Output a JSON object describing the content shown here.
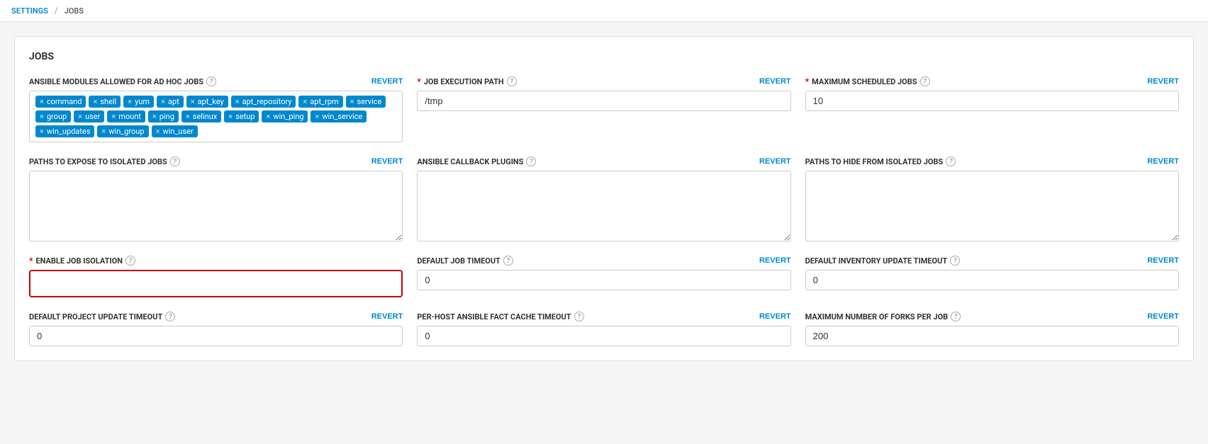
{
  "breadcrumb": {
    "settings": "SETTINGS",
    "separator": "/",
    "current": "JOBS"
  },
  "card": {
    "title": "JOBS"
  },
  "fields": {
    "ansible_modules": {
      "label": "ANSIBLE MODULES ALLOWED FOR AD HOC JOBS",
      "required": false,
      "help": "?",
      "revert": "REVERT",
      "tags": [
        "command",
        "shell",
        "yum",
        "apt",
        "apt_key",
        "apt_repository",
        "apt_rpm",
        "service",
        "group",
        "user",
        "mount",
        "ping",
        "selinux",
        "setup",
        "win_ping",
        "win_service",
        "win_updates",
        "win_group",
        "win_user"
      ]
    },
    "job_execution_path": {
      "label": "JOB EXECUTION PATH",
      "required": true,
      "help": "?",
      "revert": "REVERT",
      "value": "/tmp"
    },
    "max_scheduled_jobs": {
      "label": "MAXIMUM SCHEDULED JOBS",
      "required": true,
      "help": "?",
      "revert": "REVERT",
      "value": "10"
    },
    "paths_to_expose": {
      "label": "PATHS TO EXPOSE TO ISOLATED JOBS",
      "required": false,
      "help": "?",
      "revert": "REVERT",
      "value": ""
    },
    "ansible_callback_plugins": {
      "label": "ANSIBLE CALLBACK PLUGINS",
      "required": false,
      "help": "?",
      "revert": "REVERT",
      "value": ""
    },
    "paths_to_hide": {
      "label": "PATHS TO HIDE FROM ISOLATED JOBS",
      "required": false,
      "help": "?",
      "revert": "REVERT",
      "value": ""
    },
    "enable_job_isolation": {
      "label": "ENABLE JOB ISOLATION",
      "required": true,
      "help": "?",
      "enabled": true
    },
    "default_job_timeout": {
      "label": "DEFAULT JOB TIMEOUT",
      "required": false,
      "help": "?",
      "revert": "REVERT",
      "value": "0"
    },
    "default_inventory_update_timeout": {
      "label": "DEFAULT INVENTORY UPDATE TIMEOUT",
      "required": false,
      "help": "?",
      "revert": "REVERT",
      "value": "0"
    },
    "default_project_update_timeout": {
      "label": "DEFAULT PROJECT UPDATE TIMEOUT",
      "required": false,
      "help": "?",
      "revert": "REVERT",
      "value": "0"
    },
    "per_host_fact_cache_timeout": {
      "label": "PER-HOST ANSIBLE FACT CACHE TIMEOUT",
      "required": false,
      "help": "?",
      "revert": "REVERT",
      "value": "0"
    },
    "max_forks_per_job": {
      "label": "MAXIMUM NUMBER OF FORKS PER JOB",
      "required": false,
      "help": "?",
      "revert": "REVERT",
      "value": "200"
    }
  }
}
